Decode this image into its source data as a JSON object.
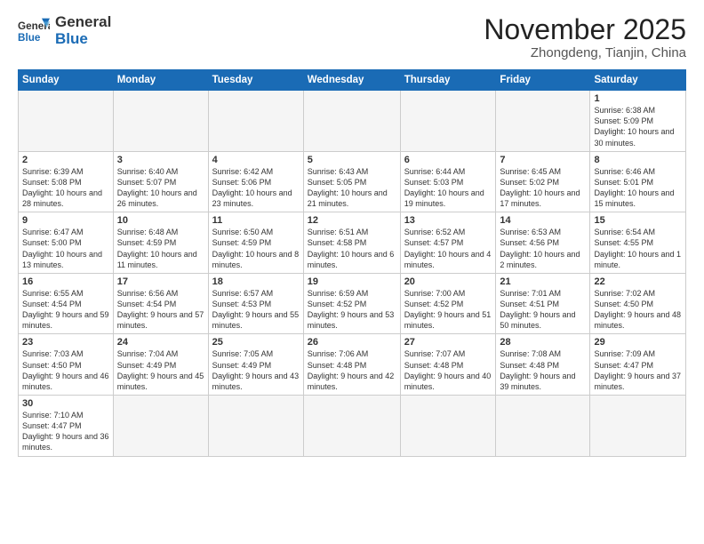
{
  "logo": {
    "line1": "General",
    "line2": "Blue"
  },
  "title": "November 2025",
  "subtitle": "Zhongdeng, Tianjin, China",
  "days_of_week": [
    "Sunday",
    "Monday",
    "Tuesday",
    "Wednesday",
    "Thursday",
    "Friday",
    "Saturday"
  ],
  "weeks": [
    [
      {
        "day": "",
        "info": ""
      },
      {
        "day": "",
        "info": ""
      },
      {
        "day": "",
        "info": ""
      },
      {
        "day": "",
        "info": ""
      },
      {
        "day": "",
        "info": ""
      },
      {
        "day": "",
        "info": ""
      },
      {
        "day": "1",
        "info": "Sunrise: 6:38 AM\nSunset: 5:09 PM\nDaylight: 10 hours and 30 minutes."
      }
    ],
    [
      {
        "day": "2",
        "info": "Sunrise: 6:39 AM\nSunset: 5:08 PM\nDaylight: 10 hours and 28 minutes."
      },
      {
        "day": "3",
        "info": "Sunrise: 6:40 AM\nSunset: 5:07 PM\nDaylight: 10 hours and 26 minutes."
      },
      {
        "day": "4",
        "info": "Sunrise: 6:42 AM\nSunset: 5:06 PM\nDaylight: 10 hours and 23 minutes."
      },
      {
        "day": "5",
        "info": "Sunrise: 6:43 AM\nSunset: 5:05 PM\nDaylight: 10 hours and 21 minutes."
      },
      {
        "day": "6",
        "info": "Sunrise: 6:44 AM\nSunset: 5:03 PM\nDaylight: 10 hours and 19 minutes."
      },
      {
        "day": "7",
        "info": "Sunrise: 6:45 AM\nSunset: 5:02 PM\nDaylight: 10 hours and 17 minutes."
      },
      {
        "day": "8",
        "info": "Sunrise: 6:46 AM\nSunset: 5:01 PM\nDaylight: 10 hours and 15 minutes."
      }
    ],
    [
      {
        "day": "9",
        "info": "Sunrise: 6:47 AM\nSunset: 5:00 PM\nDaylight: 10 hours and 13 minutes."
      },
      {
        "day": "10",
        "info": "Sunrise: 6:48 AM\nSunset: 4:59 PM\nDaylight: 10 hours and 11 minutes."
      },
      {
        "day": "11",
        "info": "Sunrise: 6:50 AM\nSunset: 4:59 PM\nDaylight: 10 hours and 8 minutes."
      },
      {
        "day": "12",
        "info": "Sunrise: 6:51 AM\nSunset: 4:58 PM\nDaylight: 10 hours and 6 minutes."
      },
      {
        "day": "13",
        "info": "Sunrise: 6:52 AM\nSunset: 4:57 PM\nDaylight: 10 hours and 4 minutes."
      },
      {
        "day": "14",
        "info": "Sunrise: 6:53 AM\nSunset: 4:56 PM\nDaylight: 10 hours and 2 minutes."
      },
      {
        "day": "15",
        "info": "Sunrise: 6:54 AM\nSunset: 4:55 PM\nDaylight: 10 hours and 1 minute."
      }
    ],
    [
      {
        "day": "16",
        "info": "Sunrise: 6:55 AM\nSunset: 4:54 PM\nDaylight: 9 hours and 59 minutes."
      },
      {
        "day": "17",
        "info": "Sunrise: 6:56 AM\nSunset: 4:54 PM\nDaylight: 9 hours and 57 minutes."
      },
      {
        "day": "18",
        "info": "Sunrise: 6:57 AM\nSunset: 4:53 PM\nDaylight: 9 hours and 55 minutes."
      },
      {
        "day": "19",
        "info": "Sunrise: 6:59 AM\nSunset: 4:52 PM\nDaylight: 9 hours and 53 minutes."
      },
      {
        "day": "20",
        "info": "Sunrise: 7:00 AM\nSunset: 4:52 PM\nDaylight: 9 hours and 51 minutes."
      },
      {
        "day": "21",
        "info": "Sunrise: 7:01 AM\nSunset: 4:51 PM\nDaylight: 9 hours and 50 minutes."
      },
      {
        "day": "22",
        "info": "Sunrise: 7:02 AM\nSunset: 4:50 PM\nDaylight: 9 hours and 48 minutes."
      }
    ],
    [
      {
        "day": "23",
        "info": "Sunrise: 7:03 AM\nSunset: 4:50 PM\nDaylight: 9 hours and 46 minutes."
      },
      {
        "day": "24",
        "info": "Sunrise: 7:04 AM\nSunset: 4:49 PM\nDaylight: 9 hours and 45 minutes."
      },
      {
        "day": "25",
        "info": "Sunrise: 7:05 AM\nSunset: 4:49 PM\nDaylight: 9 hours and 43 minutes."
      },
      {
        "day": "26",
        "info": "Sunrise: 7:06 AM\nSunset: 4:48 PM\nDaylight: 9 hours and 42 minutes."
      },
      {
        "day": "27",
        "info": "Sunrise: 7:07 AM\nSunset: 4:48 PM\nDaylight: 9 hours and 40 minutes."
      },
      {
        "day": "28",
        "info": "Sunrise: 7:08 AM\nSunset: 4:48 PM\nDaylight: 9 hours and 39 minutes."
      },
      {
        "day": "29",
        "info": "Sunrise: 7:09 AM\nSunset: 4:47 PM\nDaylight: 9 hours and 37 minutes."
      }
    ],
    [
      {
        "day": "30",
        "info": "Sunrise: 7:10 AM\nSunset: 4:47 PM\nDaylight: 9 hours and 36 minutes."
      },
      {
        "day": "",
        "info": ""
      },
      {
        "day": "",
        "info": ""
      },
      {
        "day": "",
        "info": ""
      },
      {
        "day": "",
        "info": ""
      },
      {
        "day": "",
        "info": ""
      },
      {
        "day": "",
        "info": ""
      }
    ]
  ]
}
